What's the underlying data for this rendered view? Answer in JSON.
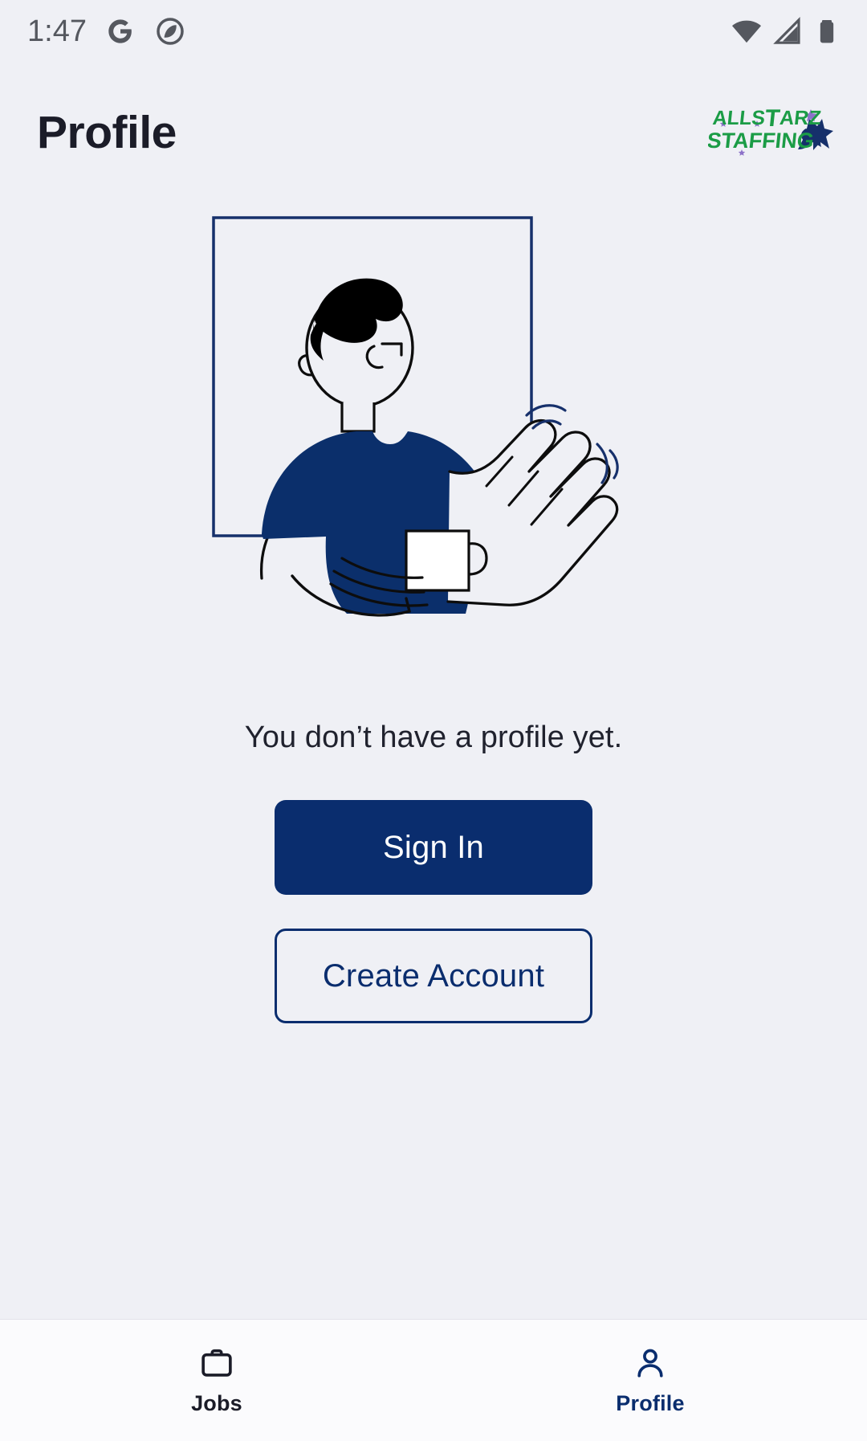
{
  "status_bar": {
    "time": "1:47",
    "left_icons": [
      "google-g-icon",
      "circle-slash-icon"
    ],
    "right_icons": [
      "wifi-icon",
      "cellular-signal-icon",
      "battery-icon"
    ],
    "icon_color": "#55585f"
  },
  "header": {
    "title": "Profile",
    "title_color": "#1b1c28",
    "logo": {
      "name": "allstarz-staffing-logo",
      "line1": "ALLSTARZ",
      "line2": "STAFFING",
      "green": "#1b9c46",
      "purple": "#8d72c9",
      "navy": "#16306b"
    }
  },
  "main": {
    "illustration": {
      "name": "waving-person-illustration",
      "frame_color": "#16306b",
      "shirt_color": "#0b2f6b",
      "hair_color": "#000000",
      "line_color": "#0d0d0d"
    },
    "empty_message": "You don’t have a profile yet.",
    "buttons": [
      {
        "name": "sign-in-button",
        "label": "Sign In",
        "style": "primary",
        "bg": "#0a2d6e",
        "fg": "#ffffff"
      },
      {
        "name": "create-account-button",
        "label": "Create Account",
        "style": "secondary",
        "bg": "transparent",
        "fg": "#0a2d6e"
      }
    ]
  },
  "bottom_nav": {
    "background": "#fbfbfd",
    "active_color": "#0a2d6e",
    "inactive_color": "#1b1c28",
    "items": [
      {
        "name": "nav-jobs",
        "label": "Jobs",
        "icon": "briefcase-icon",
        "active": false
      },
      {
        "name": "nav-profile",
        "label": "Profile",
        "icon": "person-icon",
        "active": true
      }
    ]
  },
  "theme": {
    "background": "#eff0f5",
    "accent_navy": "#0a2d6e"
  }
}
